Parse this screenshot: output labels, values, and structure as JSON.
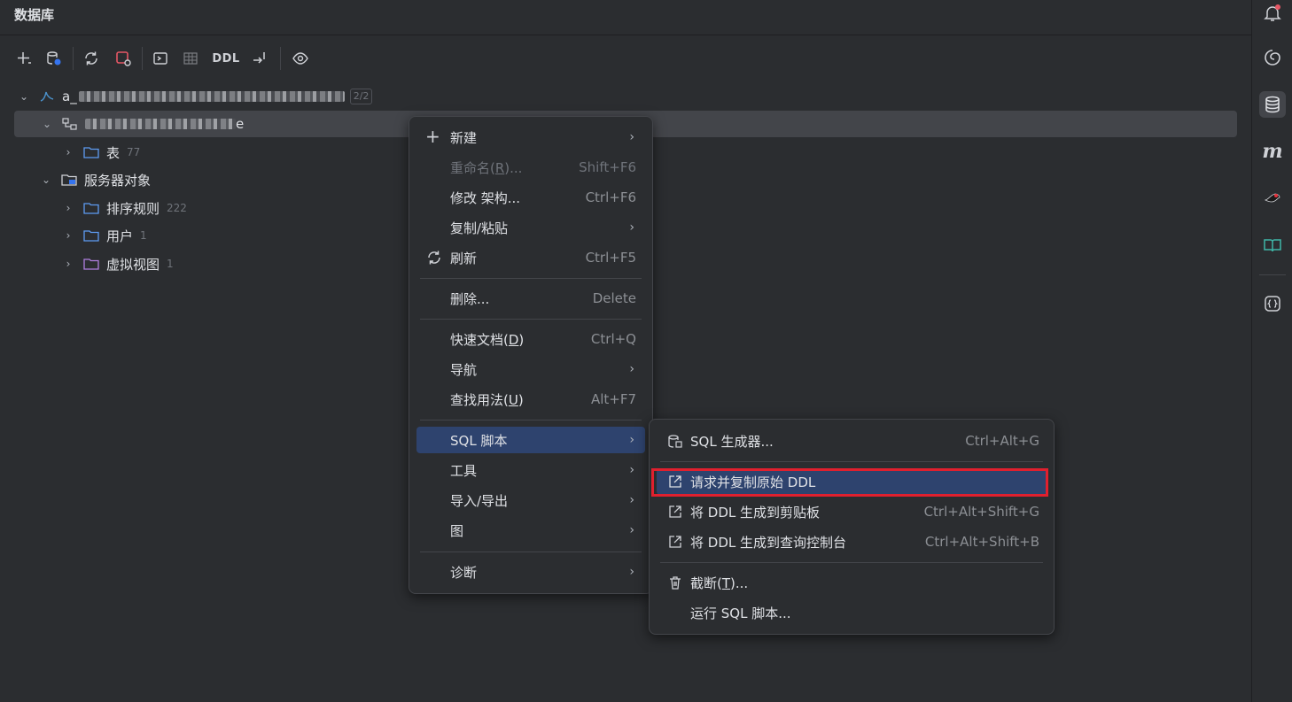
{
  "panel": {
    "title": "数据库"
  },
  "toolbar": {
    "ddl_label": "DDL"
  },
  "tree": {
    "connection": {
      "label_prefix": "a_",
      "badge": "2/2"
    },
    "schema": {
      "label_suffix": "e"
    },
    "table_folder": {
      "label": "表",
      "count": "77"
    },
    "server_objects": {
      "label": "服务器对象"
    },
    "collations": {
      "label": "排序规则",
      "count": "222"
    },
    "users": {
      "label": "用户",
      "count": "1"
    },
    "virtual_views": {
      "label": "虚拟视图",
      "count": "1"
    }
  },
  "context_menu": {
    "new": {
      "label": "新建"
    },
    "rename": {
      "label_a": "重命名(",
      "mnemonic": "R",
      "label_b": ")...",
      "shortcut": "Shift+F6"
    },
    "modify": {
      "label": "修改 架构...",
      "shortcut": "Ctrl+F6"
    },
    "copy_paste": {
      "label": "复制/粘贴"
    },
    "refresh": {
      "label": "刷新",
      "shortcut": "Ctrl+F5"
    },
    "delete": {
      "label": "删除...",
      "shortcut": "Delete"
    },
    "quick_doc": {
      "label_a": "快速文档(",
      "mnemonic": "D",
      "label_b": ")",
      "shortcut": "Ctrl+Q"
    },
    "navigate": {
      "label": "导航"
    },
    "find_usages": {
      "label_a": "查找用法(",
      "mnemonic": "U",
      "label_b": ")",
      "shortcut": "Alt+F7"
    },
    "sql_scripts": {
      "label": "SQL 脚本"
    },
    "tools": {
      "label": "工具"
    },
    "import_export": {
      "label": "导入/导出"
    },
    "diagram": {
      "label": "图"
    },
    "diagnostics": {
      "label": "诊断"
    }
  },
  "submenu": {
    "sql_generator": {
      "label": "SQL 生成器...",
      "shortcut": "Ctrl+Alt+G"
    },
    "request_copy_ddl": {
      "label": "请求并复制原始 DDL"
    },
    "ddl_to_clipboard": {
      "label": "将 DDL 生成到剪贴板",
      "shortcut": "Ctrl+Alt+Shift+G"
    },
    "ddl_to_console": {
      "label": "将 DDL 生成到查询控制台",
      "shortcut": "Ctrl+Alt+Shift+B"
    },
    "truncate": {
      "label_a": "截断(",
      "mnemonic": "T",
      "label_b": ")..."
    },
    "run_sql_script": {
      "label": "运行 SQL 脚本..."
    }
  },
  "colors": {
    "highlight": "#2e436e",
    "annotation_box": "#e0202e",
    "background": "#2b2d30"
  }
}
